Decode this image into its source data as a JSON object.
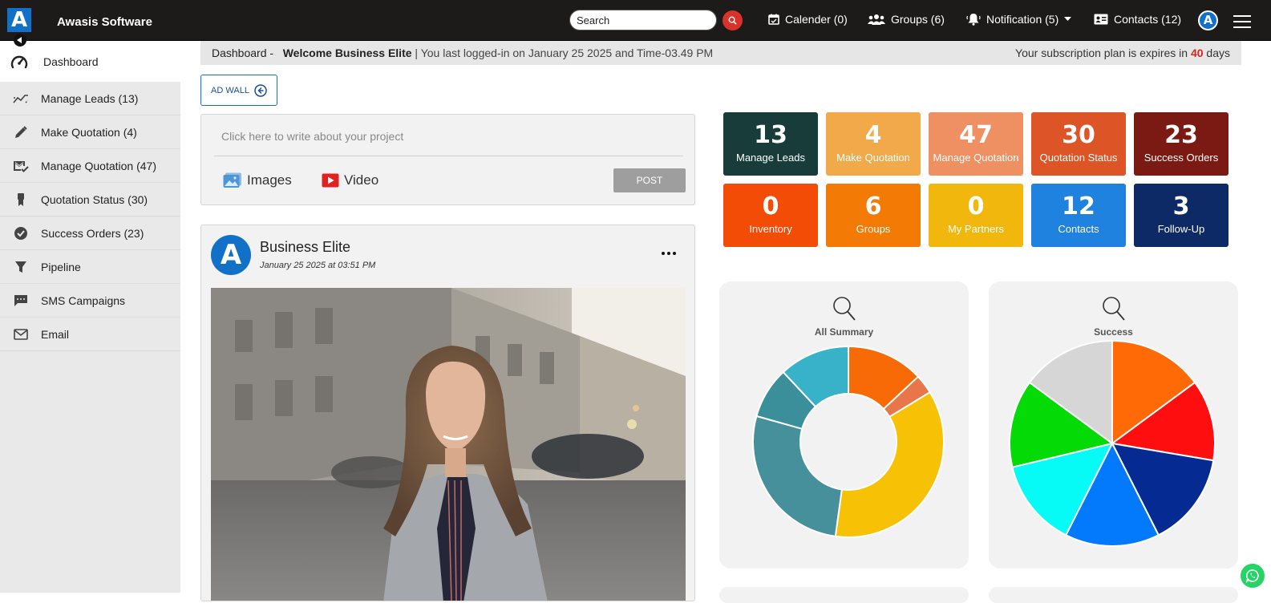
{
  "app": {
    "name": "Awasis Software",
    "logo_letter": "A"
  },
  "topbar": {
    "search_placeholder": "Search",
    "calendar": "Calender (0)",
    "groups": "Groups (6)",
    "notification": "Notification (5)",
    "contacts": "Contacts (12)",
    "avatar_letter": "A"
  },
  "sidebar": {
    "items": [
      {
        "label": "Dashboard",
        "icon": "speedometer-icon"
      },
      {
        "label": "Manage Leads (13)",
        "icon": "trend-icon"
      },
      {
        "label": "Make Quotation (4)",
        "icon": "pencil-icon"
      },
      {
        "label": "Manage Quotation (47)",
        "icon": "mail-check-icon"
      },
      {
        "label": "Quotation Status (30)",
        "icon": "award-icon"
      },
      {
        "label": "Success Orders (23)",
        "icon": "check-circle-icon"
      },
      {
        "label": "Pipeline",
        "icon": "filter-icon"
      },
      {
        "label": "SMS Campaigns",
        "icon": "chat-icon"
      },
      {
        "label": "Email",
        "icon": "envelope-icon"
      }
    ]
  },
  "breadcrumb": {
    "section": "Dashboard -",
    "welcome": "Welcome Business Elite",
    "last_login": "| You last logged-in on January 25 2025 and Time-03.49 PM",
    "plan_prefix": "Your subscription plan is expires in",
    "plan_days": "40",
    "plan_suffix": "days"
  },
  "adwall": {
    "label": "AD WALL"
  },
  "composer": {
    "placeholder": "Click here to write about your project",
    "images_label": "Images",
    "video_label": "Video",
    "post_label": "POST"
  },
  "post": {
    "author": "Business Elite",
    "avatar_letter": "A",
    "date": "January 25 2025 at 03:51 PM"
  },
  "tiles": [
    {
      "value": "13",
      "label": "Manage Leads",
      "color": "#173c3a"
    },
    {
      "value": "4",
      "label": "Make Quotation",
      "color": "#f2a94a"
    },
    {
      "value": "47",
      "label": "Manage Quotation",
      "color": "#ef9063"
    },
    {
      "value": "30",
      "label": "Quotation Status",
      "color": "#dd5426"
    },
    {
      "value": "23",
      "label": "Success Orders",
      "color": "#7b1a12"
    },
    {
      "value": "0",
      "label": "Inventory",
      "color": "#f24c06"
    },
    {
      "value": "6",
      "label": "Groups",
      "color": "#f27a05"
    },
    {
      "value": "0",
      "label": "My Partners",
      "color": "#f2b70c"
    },
    {
      "value": "12",
      "label": "Contacts",
      "color": "#1e82de"
    },
    {
      "value": "3",
      "label": "Follow-Up",
      "color": "#0d2a66"
    }
  ],
  "chart_data": [
    {
      "type": "pie",
      "variant": "doughnut",
      "title": "All Summary",
      "values": [
        12,
        3,
        33,
        25,
        8,
        11
      ],
      "colors": [
        "#f86a06",
        "#e8764a",
        "#f7c205",
        "#46909b",
        "#3a8f9b",
        "#38b2c8"
      ],
      "legend": false
    },
    {
      "type": "pie",
      "title": "Success",
      "values": [
        14,
        12,
        14,
        14,
        13,
        13,
        14
      ],
      "colors": [
        "#ff6a06",
        "#fe0e0e",
        "#052a92",
        "#0379fc",
        "#06fbf6",
        "#04da06",
        "#d6d6d6"
      ],
      "legend": false
    }
  ]
}
